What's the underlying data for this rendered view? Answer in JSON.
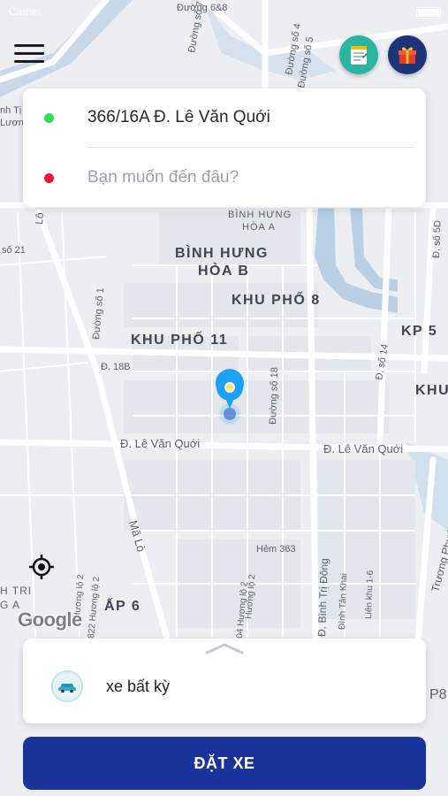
{
  "status_bar": {
    "carrier": "Carrier"
  },
  "map": {
    "streets": [
      "Đường 6&8",
      "Đường số 5",
      "Đường số 7",
      "Đường số 4",
      "Đường số 1",
      "Đ. 18B",
      "Đường số 18",
      "Đ. số 14",
      "Đ. số 5D",
      "Đ. Lê Văn Quới",
      "Đ. Lê Văn Quới",
      "Mã Lò",
      "Hẻm 363",
      "Đ. Bình Trị Đông",
      "Đình Tân Khai",
      "Liên khu 1-6",
      "Trương Phước Phan",
      "Hương lộ 2",
      "Hương lộ 2",
      "822 Hương lộ 2",
      "04 Hương lộ 2",
      "Lô",
      "số 21",
      "P8"
    ],
    "areas": [
      "BÌNH HƯNG",
      "HÒA A",
      "BÌNH HƯNG",
      "HÒA B",
      "KHU PHỐ 8",
      "KHU PHỐ 11",
      "KP 5",
      "KHU",
      "ẤP 6",
      "H TRI",
      "G A",
      "nh Tị",
      "Lươn"
    ]
  },
  "branding": {
    "map_provider": "Google"
  },
  "route": {
    "pickup_address": "366/16A Đ. Lê Văn Quới",
    "destination_placeholder": "Bạn muốn đến đâu?",
    "pickup_color": "#2ee05a",
    "destination_color": "#f0143c"
  },
  "vehicle": {
    "label": "xe bất kỳ"
  },
  "actions": {
    "book_label": "ĐẶT XE"
  },
  "colors": {
    "primary": "#1a339a",
    "notes_button": "#29b5a1",
    "gift_button": "#1e3479",
    "pin": "#1da1f2"
  },
  "icons": {
    "menu": "hamburger-icon",
    "notes": "notepad-icon",
    "gift": "gift-icon",
    "locate": "crosshair-icon",
    "handle": "chevron-up-icon",
    "vehicle": "car-icon"
  }
}
